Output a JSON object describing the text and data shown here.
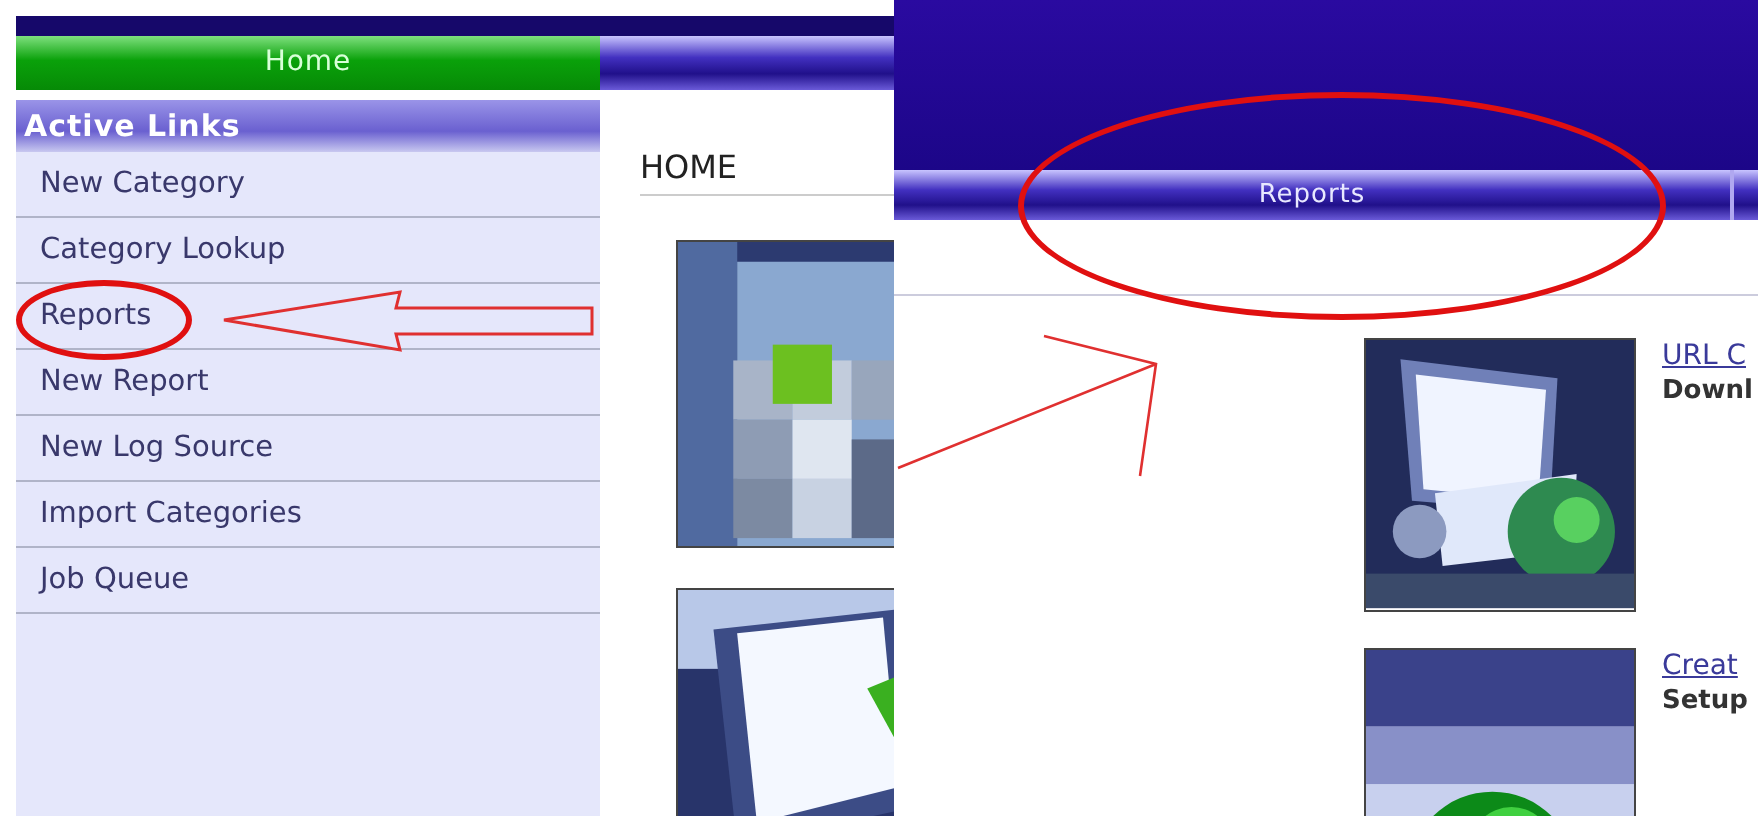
{
  "left_page": {
    "nav_tabs": [
      {
        "label": "Home",
        "selected": true
      }
    ],
    "sidebar": {
      "title": "Active Links",
      "items": [
        {
          "label": "New Category",
          "circled": false
        },
        {
          "label": "Category Lookup",
          "circled": false
        },
        {
          "label": "Reports",
          "circled": true
        },
        {
          "label": "New Report",
          "circled": false
        },
        {
          "label": "New Log Source",
          "circled": false
        },
        {
          "label": "Import Categories",
          "circled": false
        },
        {
          "label": "Job Queue",
          "circled": false
        }
      ]
    },
    "content": {
      "heading": "HOME"
    }
  },
  "right_page": {
    "nav_tabs": [
      {
        "label": "Reports",
        "selected": false,
        "circled": true
      }
    ],
    "items": [
      {
        "title": "URL C",
        "description": "Downl"
      },
      {
        "title": "Creat",
        "description": "Setup"
      }
    ]
  }
}
